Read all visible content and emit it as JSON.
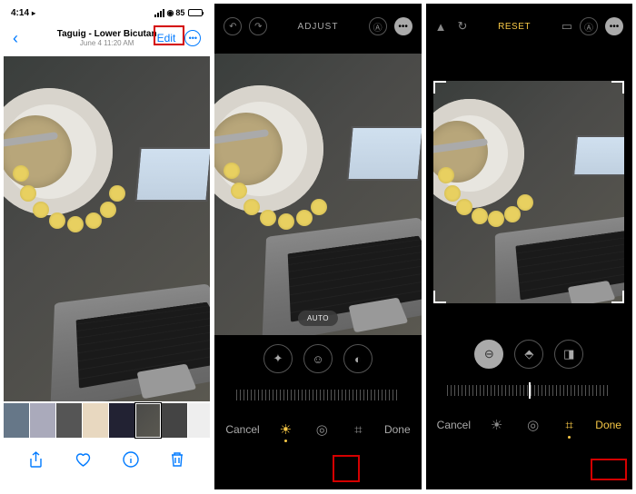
{
  "statusBar": {
    "time": "4:14",
    "arrow": "▸",
    "battery": "85"
  },
  "screen1": {
    "title": "Taguig - Lower Bicutan",
    "subtitle": "June 4  11:20 AM",
    "editLabel": "Edit",
    "moreLabel": "•••",
    "toolbar": {
      "share": "share",
      "favorite": "heart",
      "info": "info",
      "delete": "trash"
    }
  },
  "screen2": {
    "adjustTitle": "ADJUST",
    "autoLabel": "AUTO",
    "cancel": "Cancel",
    "done": "Done"
  },
  "screen3": {
    "resetTitle": "RESET",
    "cancel": "Cancel",
    "done": "Done"
  }
}
